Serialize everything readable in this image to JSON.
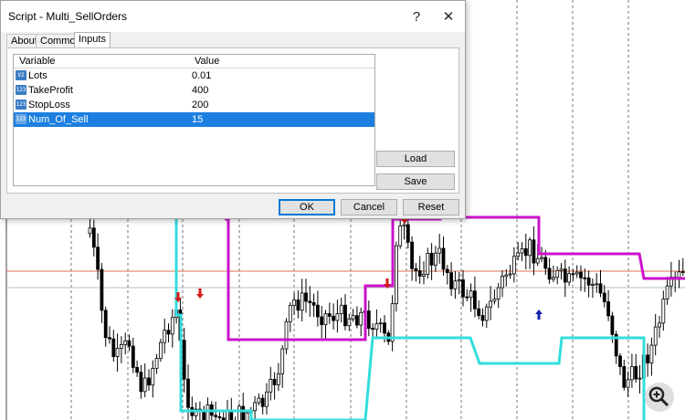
{
  "dialog": {
    "title": "Script - Multi_SellOrders",
    "help_symbol": "?",
    "close_symbol": "✕",
    "tabs": [
      {
        "label": "About",
        "active": false
      },
      {
        "label": "Common",
        "active": false
      },
      {
        "label": "Inputs",
        "active": true
      }
    ],
    "table": {
      "headers": [
        "Variable",
        "Value"
      ],
      "rows": [
        {
          "icon": "V2",
          "name": "Lots",
          "value": "0.01",
          "selected": false
        },
        {
          "icon": "123",
          "name": "TakeProfit",
          "value": "400",
          "selected": false
        },
        {
          "icon": "123",
          "name": "StopLoss",
          "value": "200",
          "selected": false
        },
        {
          "icon": "123",
          "name": "Num_Of_Sell",
          "value": "15",
          "selected": true
        }
      ]
    },
    "buttons": {
      "load": "Load",
      "save": "Save",
      "ok": "OK",
      "cancel": "Cancel",
      "reset": "Reset"
    }
  },
  "chart": {
    "colors": {
      "bullish_candle": "#ffffff",
      "bearish_candle": "#000000",
      "magenta_line": "#cc11cc",
      "cyan_line": "#33dddd",
      "price_line": "#e07050",
      "sell_arrow": "#d41a1a",
      "buy_arrow": "#1020b0"
    },
    "zoom_icon": "magnifier-plus-icon"
  }
}
